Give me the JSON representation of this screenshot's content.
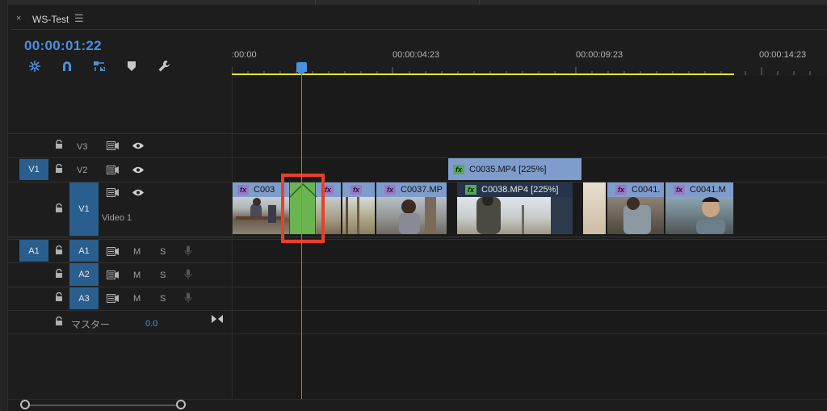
{
  "tab": {
    "close": "×",
    "title": "WS-Test",
    "menu": "☰"
  },
  "timecode": "00:00:01:22",
  "tools": [
    "snap-icon",
    "magnet-icon",
    "linked-selection-icon",
    "marker-icon",
    "wrench-icon"
  ],
  "ruler": {
    "labels": [
      ":00:00",
      "00:00:04:23",
      "00:00:09:23",
      "00:00:14:23"
    ]
  },
  "tracks": {
    "v3": {
      "name": "V3"
    },
    "v2": {
      "source": "V1",
      "name": "V2"
    },
    "v1": {
      "name": "V1",
      "label": "Video 1"
    },
    "a1": {
      "source": "A1",
      "name": "A1",
      "m": "M",
      "s": "S"
    },
    "a2": {
      "name": "A2",
      "m": "M",
      "s": "S"
    },
    "a3": {
      "name": "A3",
      "m": "M",
      "s": "S"
    },
    "master": {
      "name": "マスター",
      "value": "0.0"
    }
  },
  "clips": {
    "v2": [
      {
        "fx": "fx",
        "name": "C0035.MP4 [225%]"
      }
    ],
    "v1": [
      {
        "fx": "fx",
        "name": "C003"
      },
      {
        "fx": "fx",
        "name": ""
      },
      {
        "fx": "fx",
        "name": ""
      },
      {
        "fx": "fx",
        "name": "C0037.MP"
      },
      {
        "fx": "fx",
        "name": "C0038.MP4 [225%]"
      },
      {
        "fx": "fx",
        "name": "C0041."
      },
      {
        "fx": "fx",
        "name": "C0041.M"
      }
    ]
  },
  "colors": {
    "accent": "#4a8fe0",
    "work_area": "#e5e22e",
    "track_button": "#2a5e8e",
    "highlight": "#e8402a",
    "clip": "#7f9dcc",
    "fx_badge": "#9a78c8"
  }
}
